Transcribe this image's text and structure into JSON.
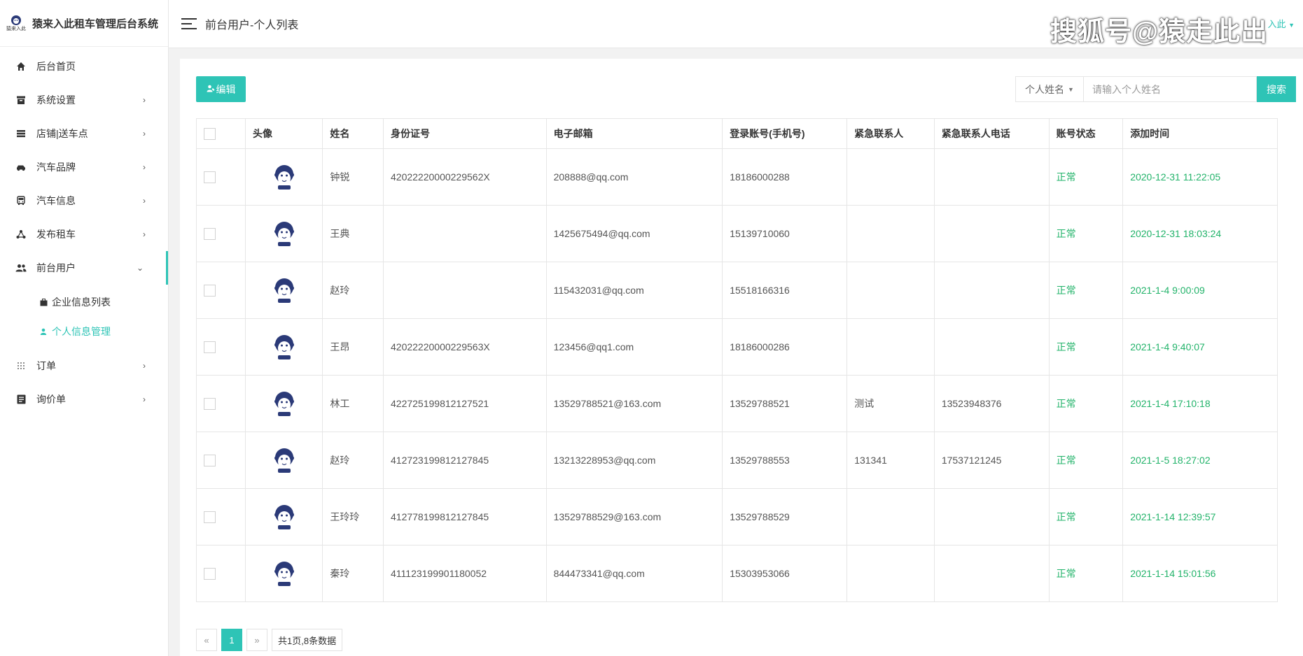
{
  "brand": {
    "logo_text": "猿来入此",
    "title": "猿来入此租车管理后台系统"
  },
  "menu": [
    {
      "label": "后台首页",
      "icon": "home-icon"
    },
    {
      "label": "系统设置",
      "icon": "archive-icon"
    },
    {
      "label": "店铺|送车点",
      "icon": "layers-icon"
    },
    {
      "label": "汽车品牌",
      "icon": "car-icon"
    },
    {
      "label": "汽车信息",
      "icon": "bus-icon"
    },
    {
      "label": "发布租车",
      "icon": "share-nodes-icon"
    },
    {
      "label": "前台用户",
      "icon": "users-icon"
    },
    {
      "label": "订单",
      "icon": "grid-dots-icon"
    },
    {
      "label": "询价单",
      "icon": "list-document-icon"
    }
  ],
  "submenu": [
    {
      "label": "企业信息列表",
      "icon": "briefcase-icon"
    },
    {
      "label": "个人信息管理",
      "icon": "person-icon"
    }
  ],
  "topbar": {
    "breadcrumb": "前台用户-个人列表",
    "watermark": "搜狐号@猿走此出",
    "user": "入此"
  },
  "toolbar": {
    "edit_label": "编辑",
    "select_value": "个人姓名",
    "search_placeholder": "请输入个人姓名",
    "search_label": "搜索"
  },
  "table": {
    "headers": [
      "头像",
      "姓名",
      "身份证号",
      "电子邮箱",
      "登录账号(手机号)",
      "紧急联系人",
      "紧急联系人电话",
      "账号状态",
      "添加时间"
    ],
    "rows": [
      {
        "name": "钟锐",
        "id": "42022220000229562X",
        "email": "208888@qq.com",
        "phone": "18186000288",
        "contact": "",
        "contact_phone": "",
        "status": "正常",
        "time": "2020-12-31 11:22:05"
      },
      {
        "name": "王典",
        "id": "",
        "email": "1425675494@qq.com",
        "phone": "15139710060",
        "contact": "",
        "contact_phone": "",
        "status": "正常",
        "time": "2020-12-31 18:03:24"
      },
      {
        "name": "赵玲",
        "id": "",
        "email": "115432031@qq.com",
        "phone": "15518166316",
        "contact": "",
        "contact_phone": "",
        "status": "正常",
        "time": "2021-1-4 9:00:09"
      },
      {
        "name": "王昂",
        "id": "42022220000229563X",
        "email": "123456@qq1.com",
        "phone": "18186000286",
        "contact": "",
        "contact_phone": "",
        "status": "正常",
        "time": "2021-1-4 9:40:07"
      },
      {
        "name": "林工",
        "id": "422725199812127521",
        "email": "13529788521@163.com",
        "phone": "13529788521",
        "contact": "测试",
        "contact_phone": "13523948376",
        "status": "正常",
        "time": "2021-1-4 17:10:18"
      },
      {
        "name": "赵玲",
        "id": "412723199812127845",
        "email": "13213228953@qq.com",
        "phone": "13529788553",
        "contact": "131341",
        "contact_phone": "17537121245",
        "status": "正常",
        "time": "2021-1-5 18:27:02"
      },
      {
        "name": "王玲玲",
        "id": "412778199812127845",
        "email": "13529788529@163.com",
        "phone": "13529788529",
        "contact": "",
        "contact_phone": "",
        "status": "正常",
        "time": "2021-1-14 12:39:57"
      },
      {
        "name": "秦玲",
        "id": "411123199901180052",
        "email": "844473341@qq.com",
        "phone": "15303953066",
        "contact": "",
        "contact_phone": "",
        "status": "正常",
        "time": "2021-1-14 15:01:56"
      }
    ]
  },
  "pager": {
    "prev": "«",
    "current": "1",
    "next": "»",
    "info": "共1页,8条数据"
  },
  "colors": {
    "accent": "#2ec4b6",
    "status_green": "#22b36a"
  }
}
